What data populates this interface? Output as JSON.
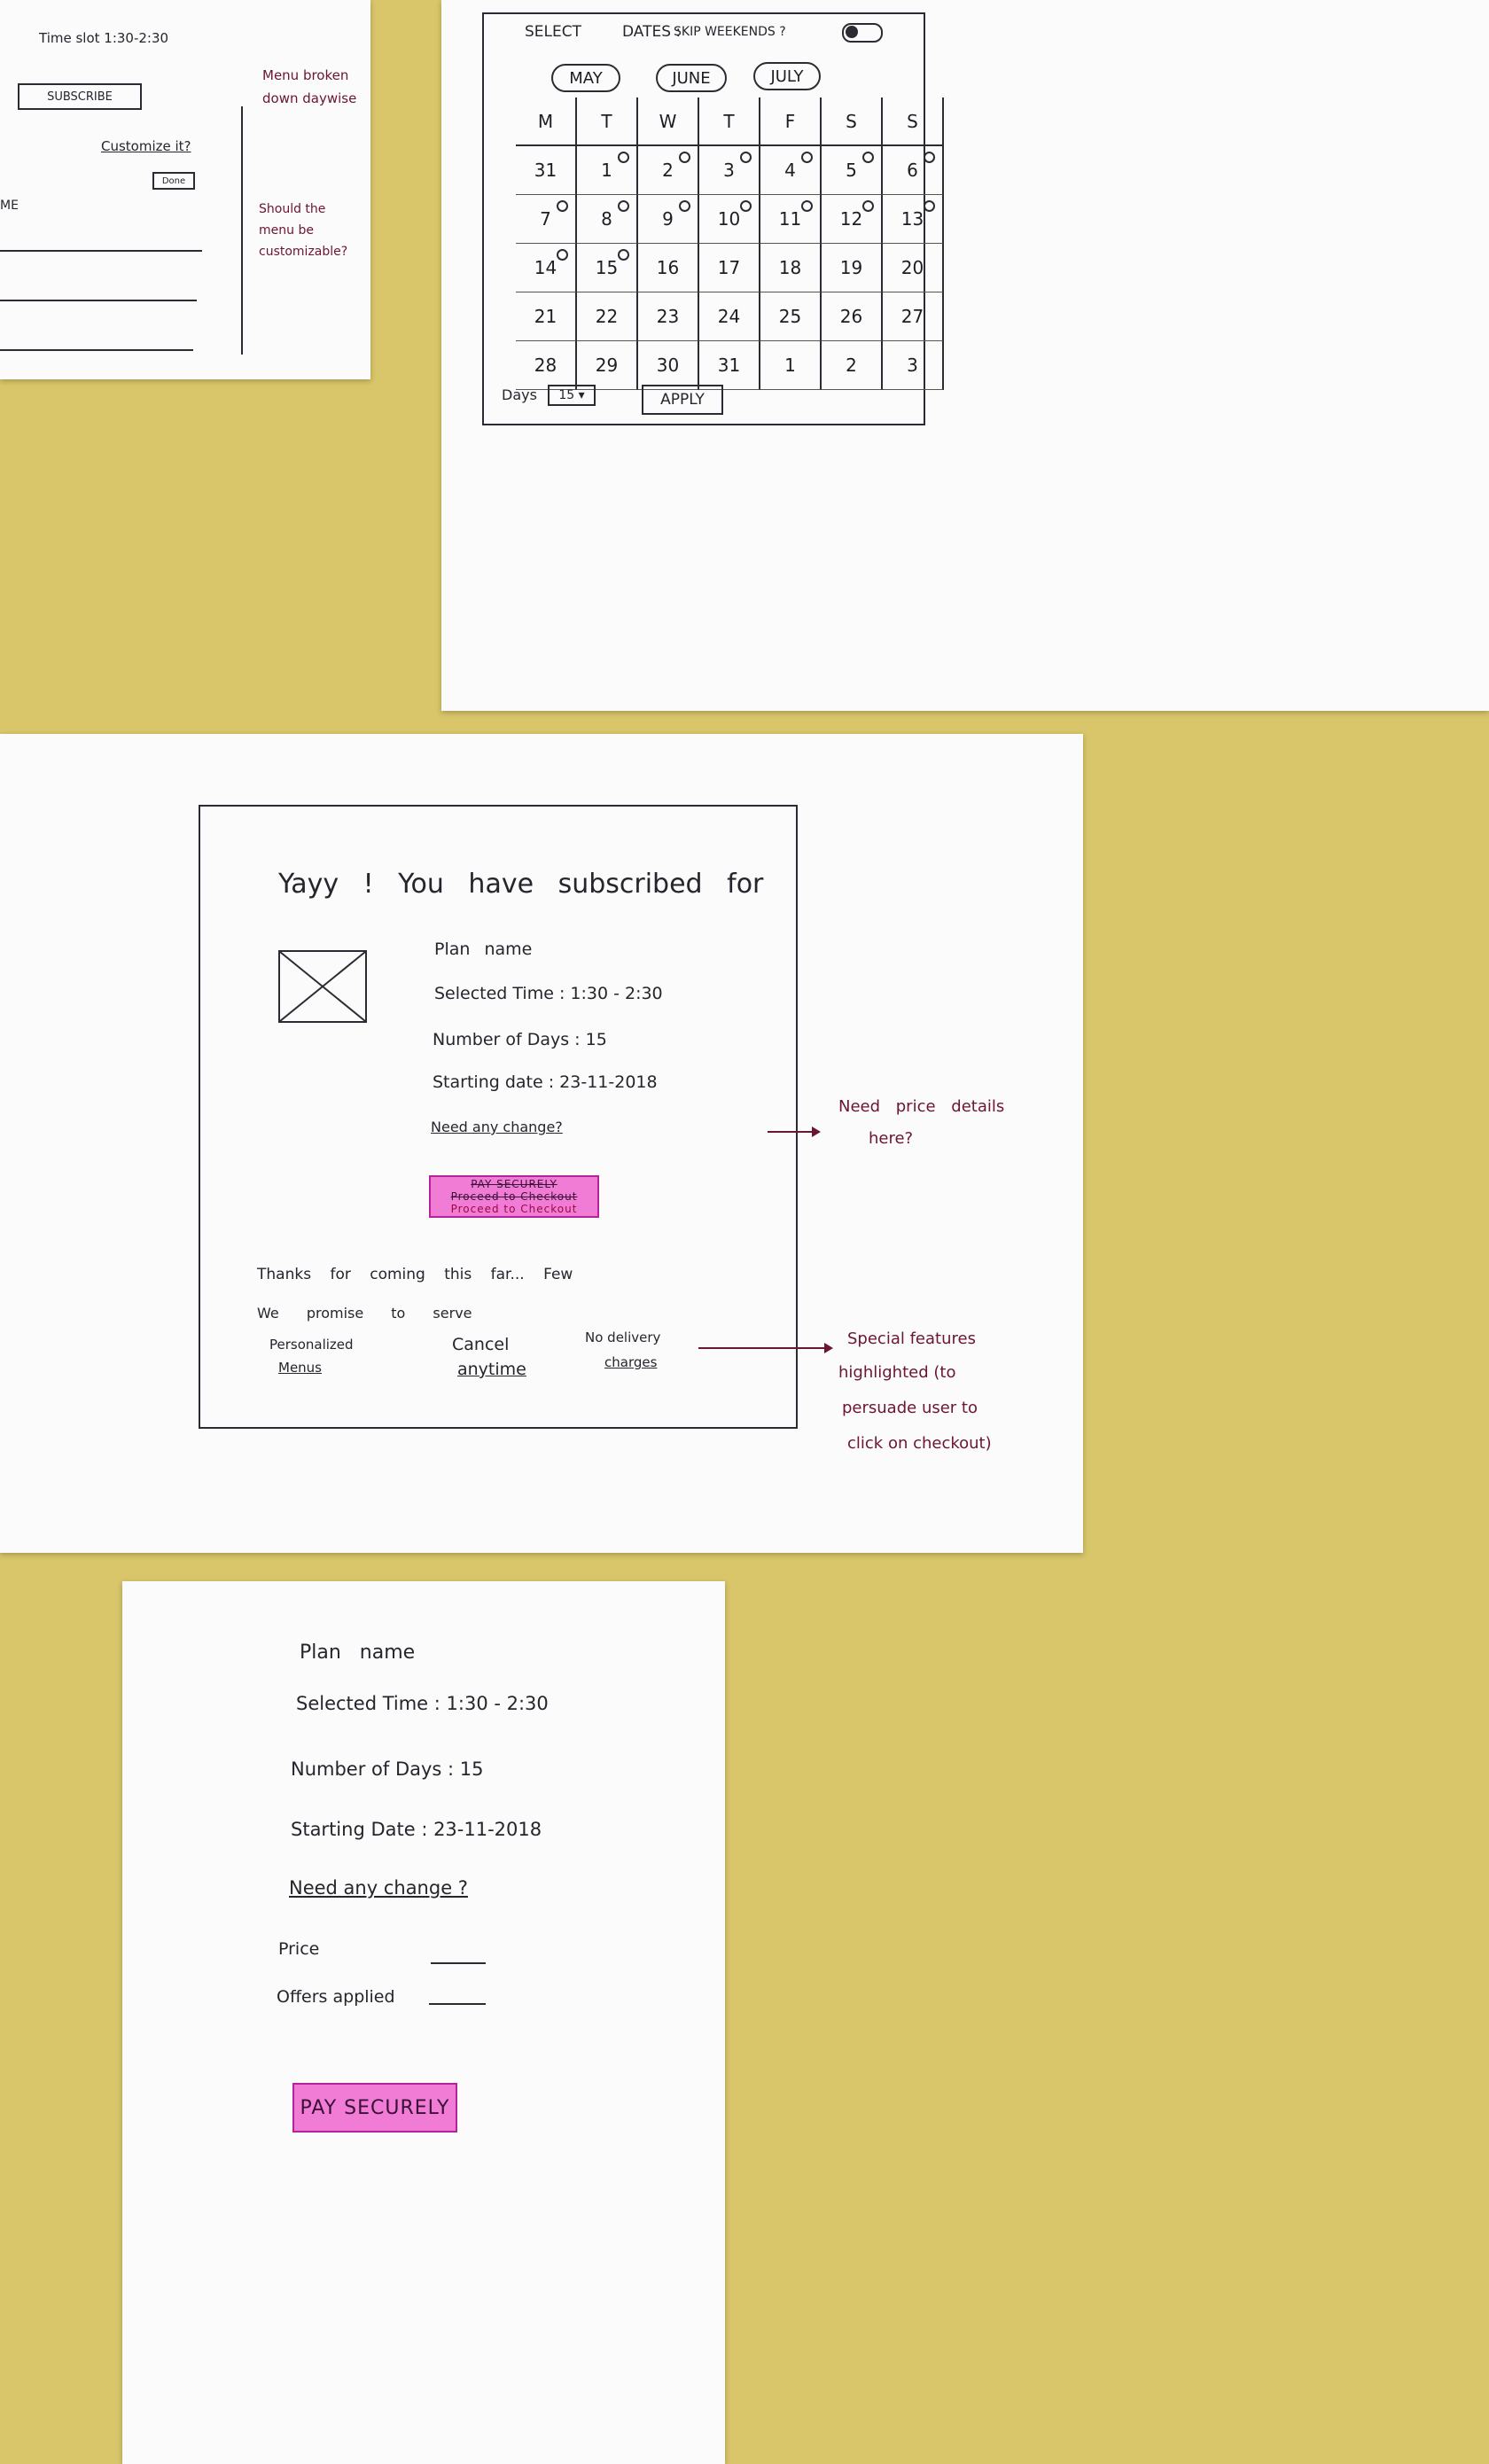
{
  "sheet1": {
    "title_line": "Time slot 1:30-2:30",
    "subscribe_label": "SUBSCRIBE",
    "customize_label": "Customize it?",
    "small_btn_label": "Done",
    "name_label": "ME",
    "note_menu": "Menu broken down daywise",
    "note_customizable": "Should the menu be customizable?"
  },
  "calendar": {
    "select_label": "SELECT",
    "dates_label": "DATES :",
    "skip_weekends_label": "SKIP WEEKENDS ?",
    "months": [
      "MAY",
      "JUNE",
      "JULY"
    ],
    "weekdays": [
      "M",
      "T",
      "W",
      "T",
      "F",
      "S",
      "S"
    ],
    "rows": [
      [
        "31",
        "1",
        "2",
        "3",
        "4",
        "5",
        "6"
      ],
      [
        "7",
        "8",
        "9",
        "10",
        "11",
        "12",
        "13"
      ],
      [
        "14",
        "15",
        "16",
        "17",
        "18",
        "19",
        "20"
      ],
      [
        "21",
        "22",
        "23",
        "24",
        "25",
        "26",
        "27"
      ],
      [
        "28",
        "29",
        "30",
        "31",
        "1",
        "2",
        "3"
      ]
    ],
    "days_label": "Days",
    "days_value": "15 ▾",
    "apply_label": "APPLY"
  },
  "confirm": {
    "heading": "Yayy ! You have subscribed for",
    "plan_name": "Plan name",
    "selected_time": "Selected Time : 1:30 - 2:30",
    "number_of_days": "Number of Days : 15",
    "starting_date": "Starting date : 23-11-2018",
    "need_change": "Need any change?",
    "pay_btn_top": "PAY SECURELY",
    "pay_btn_mid": "Proceed to Checkout",
    "pay_btn_bottom": "Proceed to Checkout",
    "thanks_line": "Thanks for coming this far... Few",
    "promise_line": "We promise to serve",
    "feature1_line1": "Personalized",
    "feature1_line2": "Menus",
    "feature2_line1": "Cancel",
    "feature2_line2": "anytime",
    "feature3_line1": "No delivery",
    "feature3_line2": "charges",
    "note_price_line1": "Need price details",
    "note_price_line2": "here?",
    "note_features_line1": "Special features",
    "note_features_line2": "highlighted (to",
    "note_features_line3": "persuade user to",
    "note_features_line4": "click on checkout)"
  },
  "checkout": {
    "plan_name": "Plan name",
    "selected_time": "Selected Time : 1:30 - 2:30",
    "number_of_days": "Number of Days : 15",
    "starting_date": "Starting Date : 23-11-2018",
    "need_change": "Need any change ?",
    "price_label": "Price",
    "offer_label": "Offers applied",
    "pay_label": "PAY SECURELY"
  },
  "colors": {
    "table": "#d9c66a",
    "paper": "#fbfbfb",
    "ink": "#1d1d24",
    "note_ink": "#6b1630",
    "button_pink": "#f07cd6"
  }
}
